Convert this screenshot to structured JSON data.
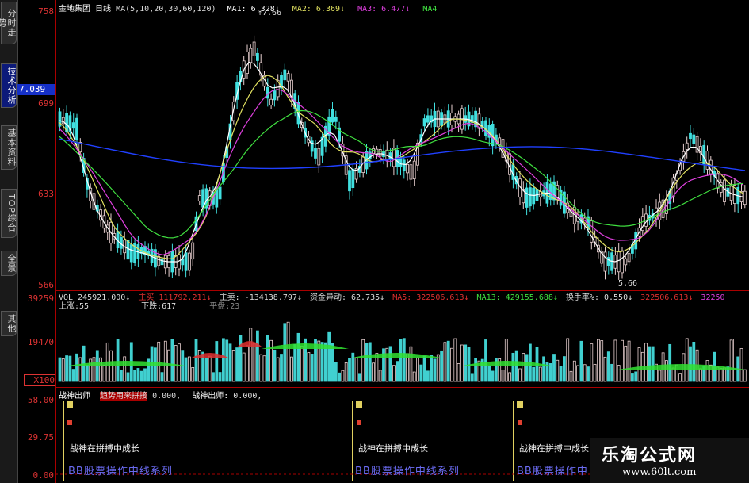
{
  "sidebar": {
    "tabs": [
      {
        "label": "分时走势"
      },
      {
        "label": "技术分析"
      },
      {
        "label": "基本资料"
      },
      {
        "label": "TOP综合"
      },
      {
        "label": "全景"
      },
      {
        "label": "其他"
      }
    ]
  },
  "price_axis": {
    "top": "758",
    "current": "7.039",
    "l699": "699",
    "l633": "633",
    "l566": "566"
  },
  "vol_axis": {
    "top": "39259",
    "mid": "19470",
    "bottom": "X100"
  },
  "ind_axis": {
    "top": "58.00",
    "mid": "29.75",
    "bottom": "0.00"
  },
  "header": {
    "stock": "金地集团",
    "period": "日线",
    "ma_params": "MA(5,10,20,30,60,120)",
    "ma1": "MA1: 6.328↓",
    "ma1_extra": "↑7.66",
    "ma2": "MA2: 6.369↓",
    "ma3": "MA3: 6.477↓",
    "ma4": "MA4"
  },
  "vol_header": {
    "vol": "VOL 245921.000↓",
    "zhuli": "主买",
    "zhuli_v": "111792.211↓",
    "zhumai": "主卖: -134138.797↓",
    "zijin": "资金异动: 62.735↓",
    "ma5": "MA5: 322506.613↓",
    "ma13": "MA13: 429155.688↓",
    "huanshou": "换手率%: 0.550↓",
    "v2": "322506.613↓",
    "v3": "32250",
    "up": "上涨:55",
    "down": "下跌:617",
    "flat": "平盘:23"
  },
  "ind_header": {
    "name": "战神出师",
    "sub": "趋势用来拼接",
    "v1": "0.000,",
    "name2": "战神出师:",
    "v2": "0.000,"
  },
  "annotations": {
    "a1": "战神在拼搏中成长",
    "a2": "战神在拼搏中成长",
    "a3": "战神在拼搏中成长",
    "series": "BB股票操作中线系列"
  },
  "price_marks": {
    "high": "7.66",
    "low": "5.66"
  },
  "watermark": {
    "title": "乐淘公式网",
    "url": "www.60lt.com"
  },
  "colors": {
    "up": "#e8e0e0",
    "down": "#40e0e0",
    "ma1": "#ffffff",
    "ma2": "#e0e060",
    "ma3": "#e040e0",
    "ma4": "#40e040",
    "ma5": "#2040ff"
  }
}
